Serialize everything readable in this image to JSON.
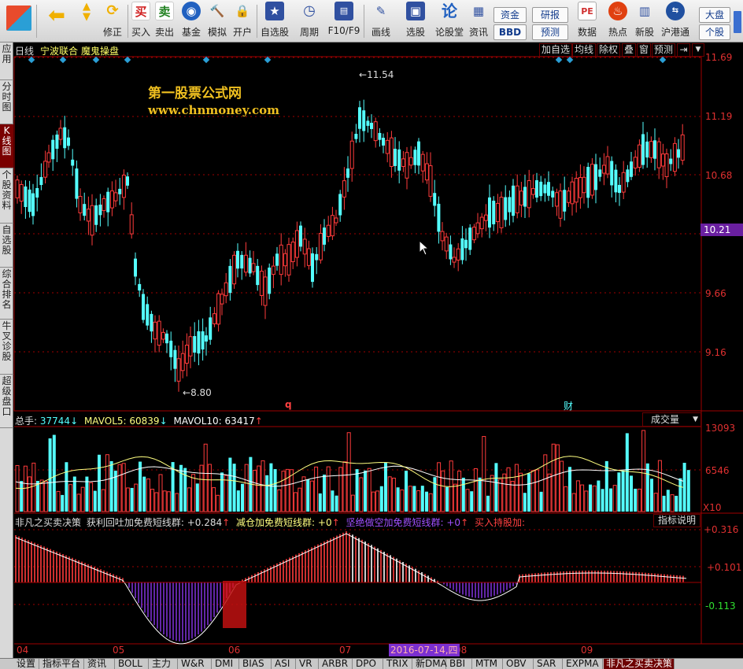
{
  "toolbar": {
    "items": [
      {
        "label": "",
        "icon": "grid-logo-icon",
        "color": "#e84b2c"
      },
      {
        "label": "",
        "icon": "back-arrow-icon",
        "color": "#f0b000"
      },
      {
        "label": "",
        "icon": "up-down-arrows-icon",
        "color": "#f0b000"
      },
      {
        "label": "修正",
        "icon": "refresh-icon",
        "color": "#f0b000"
      },
      {
        "label": "买入",
        "icon": "buy-icon",
        "glyph": "买",
        "color": "#d02020"
      },
      {
        "label": "卖出",
        "icon": "sell-icon",
        "glyph": "卖",
        "color": "#208020"
      },
      {
        "label": "基金",
        "icon": "fund-icon",
        "color": "#2060c0"
      },
      {
        "label": "模拟",
        "icon": "hammer-icon",
        "color": "#c05010"
      },
      {
        "label": "开户",
        "icon": "lock-icon",
        "color": "#d09020"
      },
      {
        "label": "自选股",
        "icon": "star-list-icon",
        "color": "#3050a0"
      },
      {
        "label": "周期",
        "icon": "clock-icon",
        "color": "#3050a0"
      },
      {
        "label": "F10/F9",
        "icon": "f10-icon",
        "color": "#3050a0"
      },
      {
        "label": "画线",
        "icon": "pencil-icon",
        "color": "#3050a0"
      },
      {
        "label": "选股",
        "icon": "screen-icon",
        "color": "#3050a0"
      },
      {
        "label": "论股堂",
        "icon": "forum-icon",
        "glyph": "论",
        "color": "#2060c0"
      },
      {
        "label": "资讯",
        "icon": "news-icon",
        "color": "#3050a0"
      },
      {
        "label": "数据",
        "icon": "pe-icon",
        "glyph": "PE",
        "color": "#d03030"
      },
      {
        "label": "热点",
        "icon": "fire-icon",
        "color": "#e04010"
      },
      {
        "label": "新股",
        "icon": "new-stock-icon",
        "color": "#3050a0"
      },
      {
        "label": "沪港通",
        "icon": "hk-connect-icon",
        "color": "#2050a0"
      }
    ],
    "small_buttons": {
      "zijin": "资金",
      "bbd": "BBD",
      "yanbao": "研报",
      "yuce": "预测",
      "dapan": "大盘",
      "gegu": "个股"
    }
  },
  "side_tabs": [
    "应用",
    "分时图",
    "K线图",
    "个股资料",
    "自选股",
    "综合排名",
    "牛叉诊股",
    "超级盘口"
  ],
  "chart_header": {
    "period": "日线",
    "stock_name": "宁波联合",
    "formula_name": "魔鬼操盘",
    "buttons": [
      "加自选",
      "均线",
      "除权",
      "叠",
      "窗",
      "预测"
    ]
  },
  "watermark": {
    "line1": "第一股票公式网",
    "line2": "www.chnmoney.com"
  },
  "price_axis": {
    "ticks": [
      "11.69",
      "11.19",
      "10.68",
      "10.21",
      "9.66",
      "9.16"
    ],
    "current": "10.21",
    "high_label": "11.54",
    "low_label": "8.80",
    "marker_q": "q",
    "marker_cai": "财"
  },
  "volume_pane": {
    "label_total": "总手:",
    "total": "37744",
    "label_ma5": "MAVOL5:",
    "ma5": "60839",
    "label_ma10": "MAVOL10:",
    "ma10": "63417",
    "dropdown": "成交量",
    "ticks": [
      "13093",
      "6546"
    ],
    "unit": "X10"
  },
  "indicator_pane": {
    "name": "非凡之买卖决策",
    "item1": "获利回吐加免费短线群:",
    "item1_val": "+0.284",
    "item2": "减仓加免费短线群:",
    "item2_val": "+0",
    "item3": "坚绝做空加免费短线群:",
    "item3_val": "+0",
    "item4": "买入持股加:",
    "explain": "指标说明",
    "ticks": [
      "+0.316",
      "+0.101",
      "-0.113"
    ]
  },
  "x_axis": {
    "months": [
      "04",
      "05",
      "06",
      "07",
      "08",
      "09"
    ],
    "cursor_date": "2016-07-14,四"
  },
  "bottom_tabs": [
    "设置",
    "指标平台",
    "资讯",
    "BOLL",
    "主力",
    "W&R",
    "DMI",
    "BIAS",
    "ASI",
    "VR",
    "ARBR",
    "DPO",
    "TRIX",
    "新DMA",
    "BBI",
    "MTM",
    "OBV",
    "SAR",
    "EXPMA",
    "非凡之买卖决策"
  ],
  "colors": {
    "up": "#ff3b3b",
    "down": "#54ffff",
    "grid": "#a00000",
    "ma_white": "#ffffff",
    "ma_yellow": "#ffff80",
    "purple": "#7b2fd0"
  }
}
